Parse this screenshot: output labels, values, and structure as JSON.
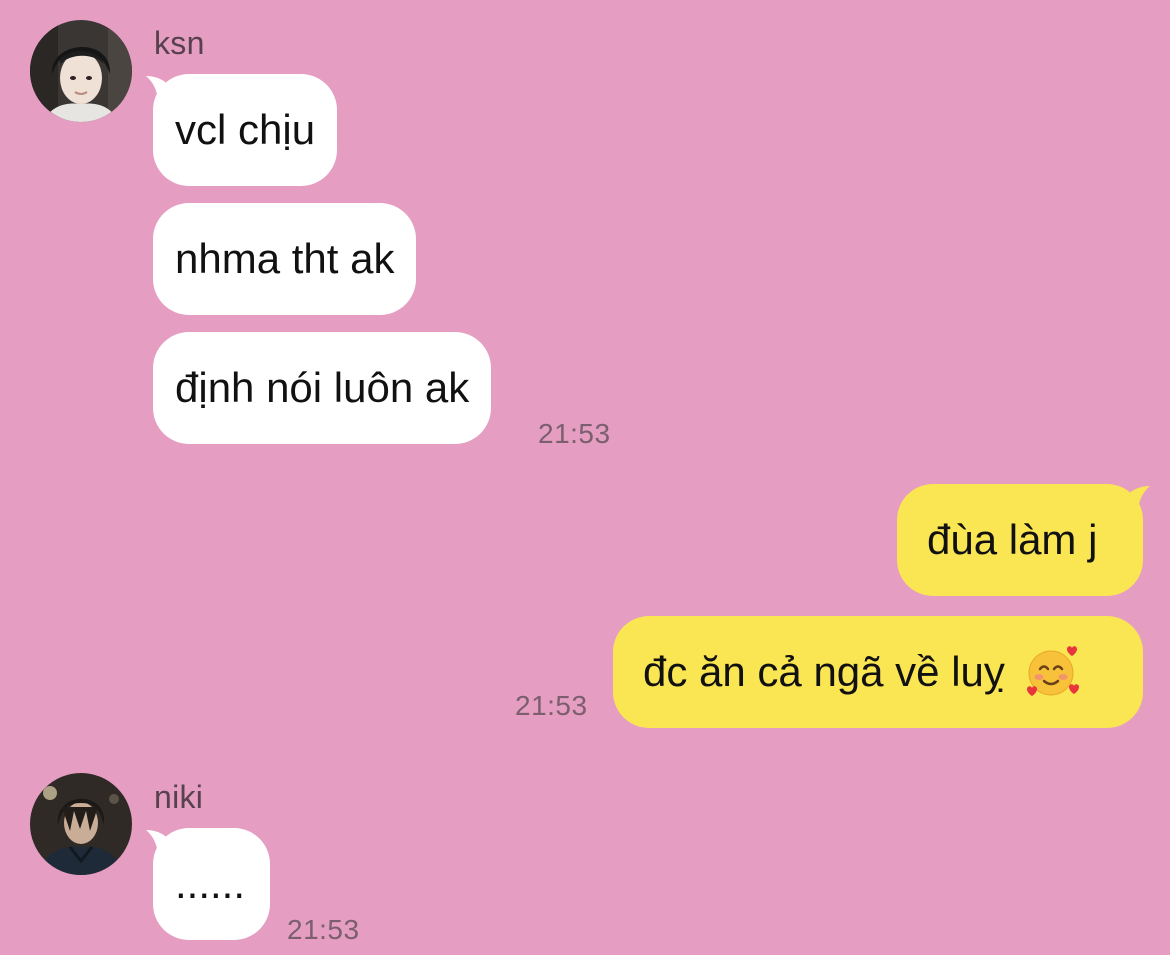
{
  "colors": {
    "background": "#e59dc1",
    "incoming_bubble": "#ffffff",
    "outgoing_bubble": "#fae553",
    "meta_text": "#7b5f6e"
  },
  "groups": [
    {
      "sender": "ksn",
      "messages": [
        "vcl chịu",
        "nhma tht ak",
        "định nói luôn ak"
      ],
      "time": "21:53"
    },
    {
      "sender": "me",
      "messages": [
        "đùa làm j",
        "đc ăn cả ngã về luỵ"
      ],
      "emoji": "smiling-face-with-hearts",
      "time": "21:53"
    },
    {
      "sender": "niki",
      "messages": [
        "......"
      ],
      "time": "21:53"
    }
  ]
}
